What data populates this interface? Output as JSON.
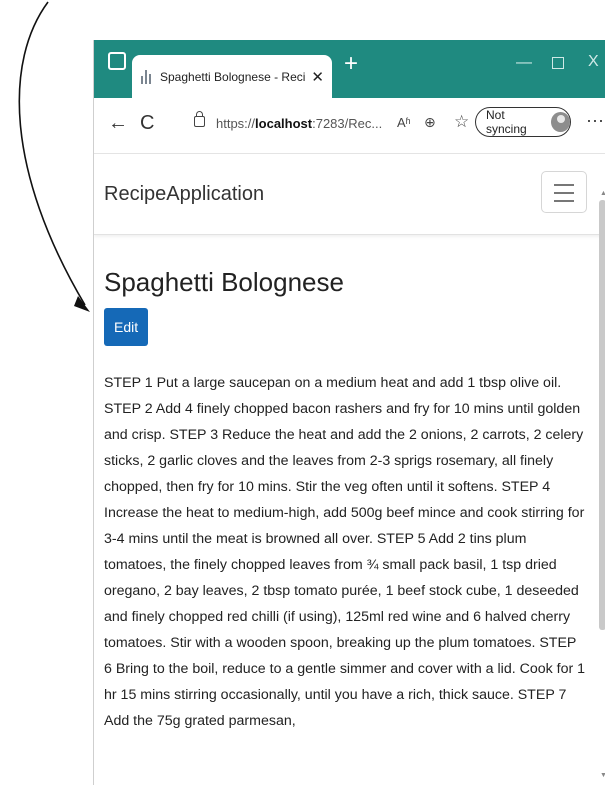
{
  "browser": {
    "tab_title": "Spaghetti Bolognese - RecipeApp",
    "tab_close": "✕",
    "new_tab": "+",
    "url_prefix": "https://",
    "url_host": "localhost",
    "url_rest": ":7283/Rec...",
    "sync_label": "Not syncing",
    "window_controls": {
      "minimize": "—",
      "close": "X"
    },
    "nav": {
      "back": "←",
      "refresh": "C",
      "more": "···"
    },
    "read_aloud": "Aʱ",
    "zoom_icon": "⊕",
    "favorite_icon": "☆",
    "accent_color": "#1f8a80"
  },
  "page": {
    "brand": "RecipeApplication",
    "title": "Spaghetti Bolognese",
    "edit_label": "Edit",
    "body": "STEP 1 Put a large saucepan on a medium heat and add 1 tbsp olive oil. STEP 2 Add 4 finely chopped bacon rashers and fry for 10 mins until golden and crisp. STEP 3 Reduce the heat and add the 2 onions, 2 carrots, 2 celery sticks, 2 garlic cloves and the leaves from 2-3 sprigs rosemary, all finely chopped, then fry for 10 mins. Stir the veg often until it softens. STEP 4 Increase the heat to medium-high, add 500g beef mince and cook stirring for 3-4 mins until the meat is browned all over. STEP 5 Add 2 tins plum tomatoes, the finely chopped leaves from ¾ small pack basil, 1 tsp dried oregano, 2 bay leaves, 2 tbsp tomato purée, 1 beef stock cube, 1 deseeded and finely chopped red chilli (if using), 125ml red wine and 6 halved cherry tomatoes. Stir with a wooden spoon, breaking up the plum tomatoes. STEP 6 Bring to the boil, reduce to a gentle simmer and cover with a lid. Cook for 1 hr 15 mins stirring occasionally, until you have a rich, thick sauce. STEP 7 Add the 75g grated parmesan,",
    "edit_color": "#1569b7"
  }
}
